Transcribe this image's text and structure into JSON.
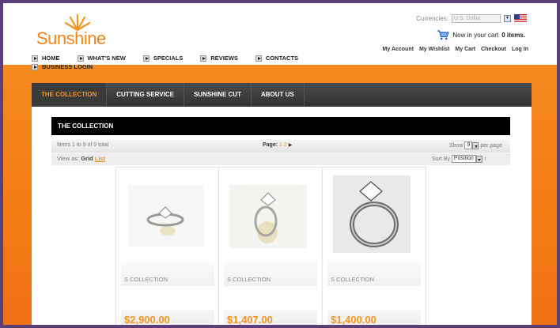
{
  "brand": {
    "logo_text_first": "Sun",
    "logo_text_rest": "shine"
  },
  "currency": {
    "label": "Currencies:",
    "selected": "U.S. Dollar"
  },
  "cart": {
    "prefix": "Now in your cart",
    "count": "0 items."
  },
  "account_links": [
    "My Account",
    "My Wishlist",
    "My Cart",
    "Checkout",
    "Log In"
  ],
  "nav": [
    "HOME",
    "WHAT'S NEW",
    "SPECIALS",
    "REVIEWS",
    "CONTACTS"
  ],
  "business_login": "BUSINESS LOGIN",
  "category_nav": [
    {
      "label": "THE COLLECTION",
      "active": true
    },
    {
      "label": "CUTTING SERVICE",
      "active": false
    },
    {
      "label": "SUNSHINE CUT",
      "active": false
    },
    {
      "label": "ABOUT US",
      "active": false
    }
  ],
  "page_title": "THE COLLECTION",
  "toolbar": {
    "items_text": "Items 1 to 9 of 9 total",
    "page_label": "Page:",
    "pages": [
      "1",
      "2"
    ],
    "show_label": "Show",
    "show_value": "9",
    "per_page": "per page",
    "view_as": "View as:",
    "grid": "Grid",
    "list": "List",
    "sort_by": "Sort By",
    "sort_value": "Position"
  },
  "products": [
    {
      "name": "S COLLECTION",
      "price": "$2,900.00"
    },
    {
      "name": "S COLLECTION",
      "price": "$1,407.00"
    },
    {
      "name": "S COLLECTION",
      "price": "$1,400.00"
    }
  ],
  "colors": {
    "accent": "#f7941d",
    "orange_bg": "#f47c14",
    "frame": "#5b3f78",
    "dark_nav": "#3a3a3a"
  },
  "icons": [
    "sun-logo-icon",
    "us-flag-icon",
    "cart-icon",
    "bullet-arrow-icon",
    "sort-arrow-icon"
  ]
}
